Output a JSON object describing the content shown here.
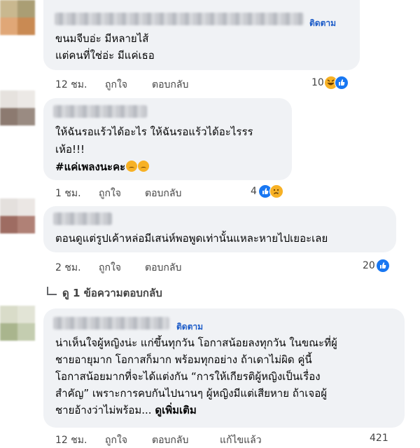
{
  "comments": [
    {
      "follow_label": "ติดตาม",
      "lines": [
        "ขนมจีบอ่ะ มีหลายไส้",
        "แต่คนที่ใช่อ่ะ มีแค่เธอ"
      ],
      "time": "12 ชม.",
      "like_label": "ถูกใจ",
      "reply_label": "ตอบกลับ",
      "reaction_count": "10",
      "reaction_icons": [
        "haha-icon",
        "like-icon"
      ]
    },
    {
      "lines": [
        "ให้ฉันรอแร้วได้อะไร ให้ฉันรอแร้วได้อะไรรร",
        "เห้อ!!!"
      ],
      "hashtag": "#แค่เพลงนะคะ",
      "time": "1 ชม.",
      "like_label": "ถูกใจ",
      "reply_label": "ตอบกลับ",
      "reaction_count": "4",
      "reaction_icons": [
        "like-icon",
        "sad-icon"
      ]
    },
    {
      "lines": [
        "ตอนดูแต่รูปเค้าหล่อมีเสน่ห์พอพูดเท่านั้นแหละหายไปเยอะเลย"
      ],
      "time": "2 ชม.",
      "like_label": "ถูกใจ",
      "reply_label": "ตอบกลับ",
      "reaction_count": "20",
      "reaction_icons": [
        "like-icon"
      ],
      "replies_label": "ดู 1 ข้อความตอบกลับ"
    },
    {
      "follow_label": "ติดตาม",
      "lines": [
        "น่าเห็นใจผู้หญิงน่ะ แก่ขึ้นทุกวัน โอกาสน้อยลงทุกวัน ในขณะที่ผู้",
        "ชายอายุมาก โอกาสก็มาก พร้อมทุกอย่าง ถ้าเดาไม่ผิด คู่นี้",
        "โอกาสน้อยมากที่จะได้แต่งกัน “การให้เกียรติผู้หญิงเป็นเรื่อง",
        "สำคัญ” เพราะการคบกันไปนานๆ ผู้หญิงมีแต่เสียหาย ถ้าเจอผู้",
        "ชายอ้างว่าไม่พร้อม..."
      ],
      "see_more": "ดูเพิ่มเติม",
      "time": "12 ชม.",
      "like_label": "ถูกใจ",
      "reply_label": "ตอบกลับ",
      "edited_label": "แก้ไขแล้ว",
      "reaction_count": "421"
    }
  ]
}
